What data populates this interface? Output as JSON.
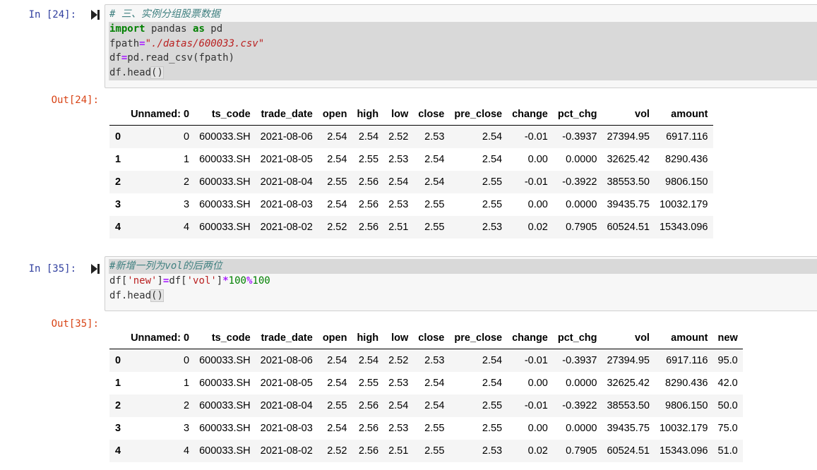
{
  "cells": [
    {
      "in_prompt": "In  [24]:",
      "out_prompt": "Out[24]:",
      "code": {
        "line1": "# 三、实例分组股票数据",
        "line2_kw1": "import",
        "line2_mid": " pandas ",
        "line2_kw2": "as",
        "line2_end": " pd",
        "line3_a": "fpath",
        "line3_eq": "=",
        "line3_str": "\"./datas/600033.csv\"",
        "line4_a": "df",
        "line4_eq": "=",
        "line4_b": "pd.read_csv(fpath)",
        "line5_a": "df.head",
        "line5_paren": "()"
      },
      "table": {
        "columns": [
          "",
          "Unnamed: 0",
          "ts_code",
          "trade_date",
          "open",
          "high",
          "low",
          "close",
          "pre_close",
          "change",
          "pct_chg",
          "vol",
          "amount"
        ],
        "rows": [
          [
            "0",
            "0",
            "600033.SH",
            "2021-08-06",
            "2.54",
            "2.54",
            "2.52",
            "2.53",
            "2.54",
            "-0.01",
            "-0.3937",
            "27394.95",
            "6917.116"
          ],
          [
            "1",
            "1",
            "600033.SH",
            "2021-08-05",
            "2.54",
            "2.55",
            "2.53",
            "2.54",
            "2.54",
            "0.00",
            "0.0000",
            "32625.42",
            "8290.436"
          ],
          [
            "2",
            "2",
            "600033.SH",
            "2021-08-04",
            "2.55",
            "2.56",
            "2.54",
            "2.54",
            "2.55",
            "-0.01",
            "-0.3922",
            "38553.50",
            "9806.150"
          ],
          [
            "3",
            "3",
            "600033.SH",
            "2021-08-03",
            "2.54",
            "2.56",
            "2.53",
            "2.55",
            "2.55",
            "0.00",
            "0.0000",
            "39435.75",
            "10032.179"
          ],
          [
            "4",
            "4",
            "600033.SH",
            "2021-08-02",
            "2.52",
            "2.56",
            "2.51",
            "2.55",
            "2.53",
            "0.02",
            "0.7905",
            "60524.51",
            "15343.096"
          ]
        ]
      }
    },
    {
      "in_prompt": "In  [35]:",
      "out_prompt": "Out[35]:",
      "code": {
        "line1": "#新增一列为vol的后两位",
        "line2_a": "df[",
        "line2_s1": "'new'",
        "line2_b": "]",
        "line2_eq": "=",
        "line2_c": "df[",
        "line2_s2": "'vol'",
        "line2_d": "]",
        "line2_op1": "*",
        "line2_n1": "100",
        "line2_op2": "%",
        "line2_n2": "100",
        "line3_a": "df.head",
        "line3_paren": "()"
      },
      "table": {
        "columns": [
          "",
          "Unnamed: 0",
          "ts_code",
          "trade_date",
          "open",
          "high",
          "low",
          "close",
          "pre_close",
          "change",
          "pct_chg",
          "vol",
          "amount",
          "new"
        ],
        "rows": [
          [
            "0",
            "0",
            "600033.SH",
            "2021-08-06",
            "2.54",
            "2.54",
            "2.52",
            "2.53",
            "2.54",
            "-0.01",
            "-0.3937",
            "27394.95",
            "6917.116",
            "95.0"
          ],
          [
            "1",
            "1",
            "600033.SH",
            "2021-08-05",
            "2.54",
            "2.55",
            "2.53",
            "2.54",
            "2.54",
            "0.00",
            "0.0000",
            "32625.42",
            "8290.436",
            "42.0"
          ],
          [
            "2",
            "2",
            "600033.SH",
            "2021-08-04",
            "2.55",
            "2.56",
            "2.54",
            "2.54",
            "2.55",
            "-0.01",
            "-0.3922",
            "38553.50",
            "9806.150",
            "50.0"
          ],
          [
            "3",
            "3",
            "600033.SH",
            "2021-08-03",
            "2.54",
            "2.56",
            "2.53",
            "2.55",
            "2.55",
            "0.00",
            "0.0000",
            "39435.75",
            "10032.179",
            "75.0"
          ],
          [
            "4",
            "4",
            "600033.SH",
            "2021-08-02",
            "2.52",
            "2.56",
            "2.51",
            "2.55",
            "2.53",
            "0.02",
            "0.7905",
            "60524.51",
            "15343.096",
            "51.0"
          ]
        ]
      }
    }
  ]
}
